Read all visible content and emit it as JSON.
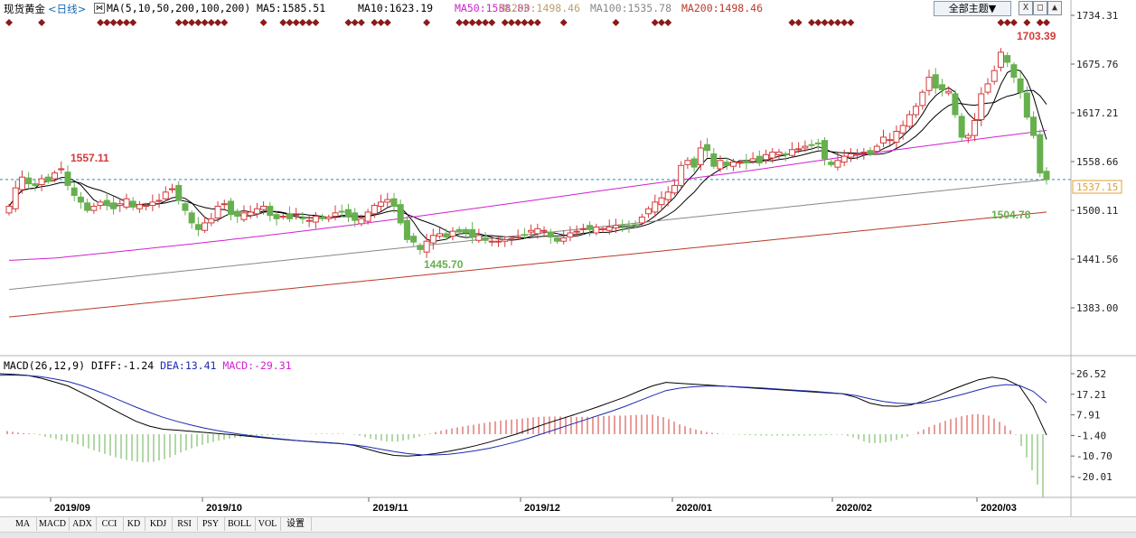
{
  "header": {
    "symbol": "现货黄金",
    "period": "<日线>",
    "ma_label": "MA(5,10,50,200,100,200)",
    "ma5": "MA5:1585.51",
    "ma10": "MA10:1623.19",
    "ma50": "MA50:1588.83",
    "ma200a": "MA200:1498.46",
    "ma100": "MA100:1535.78",
    "ma200b": "MA200:1498.46",
    "themes_label": "全部主题▼",
    "btn_close": "X",
    "btn_restore": "□",
    "btn_min": "▲"
  },
  "macd_header": {
    "label": "MACD(26,12,9)",
    "diff": "DIFF:-1.24",
    "dea": "DEA:13.41",
    "macd": "MACD:-29.31"
  },
  "current_price_tag": "1537.15",
  "colors": {
    "up": "#d43a3a",
    "down": "#66b04e",
    "ma50": "#d020d0",
    "ma100": "#888888",
    "ma200": "#b83a2a",
    "diff": "#000000",
    "dea": "#1a2ab0",
    "ref": "#2a8ab0"
  },
  "chart_data": {
    "type": "candlestick",
    "price_ticks": [
      "1734.31",
      "1675.76",
      "1617.21",
      "1558.66",
      "1500.11",
      "1441.56",
      "1383.00"
    ],
    "macd_ticks": [
      "26.52",
      "17.21",
      "7.91",
      "-1.40",
      "-10.70",
      "-20.01"
    ],
    "date_ticks": [
      "2019/09",
      "2019/10",
      "2019/11",
      "2019/12",
      "2020/01",
      "2020/02",
      "2020/03"
    ],
    "ylim": [
      1383,
      1734.31
    ],
    "macd_ylim": [
      -20.01,
      26.52
    ],
    "annotations": {
      "high": "1703.39",
      "mid_high": "1557.11",
      "low": "1445.70",
      "recent_low": "1504.78"
    },
    "closes": [
      1505,
      1527,
      1540,
      1532,
      1530,
      1538,
      1535,
      1545,
      1550,
      1530,
      1518,
      1510,
      1500,
      1505,
      1510,
      1506,
      1502,
      1508,
      1514,
      1504,
      1507,
      1506,
      1510,
      1512,
      1522,
      1526,
      1512,
      1500,
      1485,
      1477,
      1485,
      1490,
      1505,
      1508,
      1495,
      1493,
      1497,
      1498,
      1502,
      1505,
      1494,
      1490,
      1493,
      1490,
      1495,
      1490,
      1488,
      1493,
      1490,
      1492,
      1497,
      1498,
      1493,
      1488,
      1490,
      1498,
      1506,
      1510,
      1513,
      1505,
      1485,
      1465,
      1462,
      1453,
      1463,
      1470,
      1472,
      1468,
      1475,
      1474,
      1473,
      1468,
      1470,
      1464,
      1463,
      1463,
      1465,
      1466,
      1468,
      1470,
      1476,
      1478,
      1476,
      1468,
      1463,
      1467,
      1473,
      1475,
      1478,
      1477,
      1480,
      1478,
      1480,
      1482,
      1481,
      1481,
      1482,
      1492,
      1502,
      1510,
      1515,
      1522,
      1530,
      1554,
      1560,
      1552,
      1575,
      1572,
      1553,
      1560,
      1554,
      1558,
      1558,
      1557,
      1562,
      1557,
      1567,
      1570,
      1570,
      1567,
      1573,
      1574,
      1577,
      1578,
      1580,
      1562,
      1555,
      1560,
      1565,
      1568,
      1568,
      1570,
      1568,
      1577,
      1588,
      1585,
      1595,
      1602,
      1615,
      1625,
      1642,
      1660,
      1647,
      1645,
      1643,
      1615,
      1588,
      1590,
      1608,
      1640,
      1652,
      1668,
      1690,
      1678,
      1660,
      1642,
      1612,
      1590,
      1545,
      1537
    ],
    "diff": [
      26.5,
      26.2,
      25.8,
      24.5,
      22.8,
      21.0,
      18.0,
      14.8,
      11.4,
      8.1,
      5.0,
      2.8,
      1.4,
      1.0,
      0.5,
      0.0,
      -0.5,
      -1.0,
      -1.6,
      -2.2,
      -2.8,
      -3.3,
      -3.8,
      -4.2,
      -4.6,
      -5.0,
      -5.8,
      -7.5,
      -9.2,
      -10.4,
      -10.7,
      -10.3,
      -9.6,
      -8.6,
      -7.4,
      -6.0,
      -4.4,
      -2.6,
      -0.8,
      1.4,
      3.6,
      5.6,
      7.5,
      9.5,
      11.6,
      13.8,
      16.0,
      18.6,
      21.0,
      22.6,
      22.2,
      21.8,
      21.4,
      21.0,
      20.6,
      20.2,
      19.8,
      19.4,
      19.0,
      18.6,
      18.2,
      17.8,
      17.4,
      15.8,
      13.2,
      12.0,
      11.8,
      12.4,
      14.2,
      16.6,
      19.2,
      21.6,
      23.8,
      25.0,
      24.0,
      21.0,
      12.0,
      -1.2
    ],
    "dea": [
      25.8,
      25.9,
      25.7,
      25.2,
      24.2,
      23.0,
      21.2,
      19.0,
      16.6,
      14.0,
      11.4,
      9.0,
      6.8,
      5.0,
      3.4,
      2.0,
      0.8,
      -0.2,
      -1.1,
      -1.9,
      -2.6,
      -3.2,
      -3.8,
      -4.3,
      -4.7,
      -5.1,
      -5.6,
      -6.5,
      -7.6,
      -8.7,
      -9.6,
      -10.1,
      -10.2,
      -9.9,
      -9.2,
      -8.3,
      -7.2,
      -5.8,
      -4.2,
      -2.4,
      -0.4,
      1.6,
      3.6,
      5.6,
      7.6,
      9.6,
      11.8,
      14.2,
      16.6,
      18.9,
      20.0,
      20.6,
      20.9,
      20.9,
      20.7,
      20.4,
      20.1,
      19.7,
      19.3,
      18.9,
      18.5,
      18.0,
      17.5,
      16.6,
      15.2,
      14.0,
      13.2,
      12.9,
      13.3,
      14.4,
      15.9,
      17.5,
      19.2,
      20.8,
      21.6,
      21.2,
      18.6,
      13.4
    ]
  },
  "tabs": [
    "MA",
    "MACD",
    "ADX",
    "CCI",
    "KD",
    "KDJ",
    "RSI",
    "PSY",
    "BOLL",
    "VOL",
    "设置"
  ]
}
